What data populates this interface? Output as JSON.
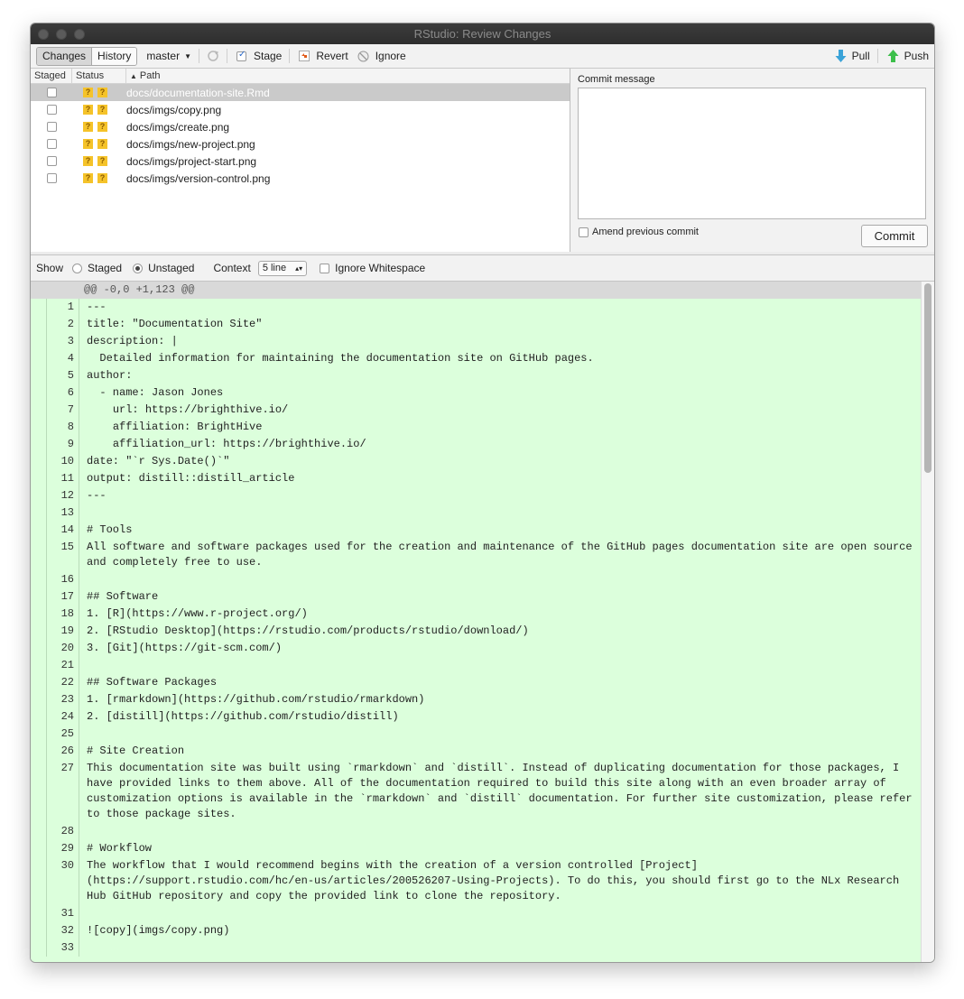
{
  "window": {
    "title": "RStudio: Review Changes"
  },
  "toolbar": {
    "changes_tab": "Changes",
    "history_tab": "History",
    "branch": "master",
    "stage": "Stage",
    "revert": "Revert",
    "ignore": "Ignore",
    "pull": "Pull",
    "push": "Push"
  },
  "file_list": {
    "headers": [
      "Staged",
      "Status",
      "Path"
    ],
    "rows": [
      {
        "path": "docs/documentation-site.Rmd",
        "status": [
          "?",
          "?"
        ]
      },
      {
        "path": "docs/imgs/copy.png",
        "status": [
          "?",
          "?"
        ]
      },
      {
        "path": "docs/imgs/create.png",
        "status": [
          "?",
          "?"
        ]
      },
      {
        "path": "docs/imgs/new-project.png",
        "status": [
          "?",
          "?"
        ]
      },
      {
        "path": "docs/imgs/project-start.png",
        "status": [
          "?",
          "?"
        ]
      },
      {
        "path": "docs/imgs/version-control.png",
        "status": [
          "?",
          "?"
        ]
      }
    ]
  },
  "commit": {
    "label": "Commit message",
    "message": "",
    "amend_label": "Amend previous commit",
    "button": "Commit"
  },
  "showbar": {
    "show": "Show",
    "staged": "Staged",
    "unstaged": "Unstaged",
    "context": "Context",
    "context_value": "5 line",
    "ignore_ws": "Ignore Whitespace"
  },
  "diff": {
    "hunk": "@@ -0,0 +1,123 @@",
    "lines": [
      {
        "n": "1",
        "t": "---"
      },
      {
        "n": "2",
        "t": "title: \"Documentation Site\""
      },
      {
        "n": "3",
        "t": "description: |"
      },
      {
        "n": "4",
        "t": "  Detailed information for maintaining the documentation site on GitHub pages."
      },
      {
        "n": "5",
        "t": "author:"
      },
      {
        "n": "6",
        "t": "  - name: Jason Jones"
      },
      {
        "n": "7",
        "t": "    url: https://brighthive.io/"
      },
      {
        "n": "8",
        "t": "    affiliation: BrightHive"
      },
      {
        "n": "9",
        "t": "    affiliation_url: https://brighthive.io/"
      },
      {
        "n": "10",
        "t": "date: \"`r Sys.Date()`\""
      },
      {
        "n": "11",
        "t": "output: distill::distill_article"
      },
      {
        "n": "12",
        "t": "---"
      },
      {
        "n": "13",
        "t": ""
      },
      {
        "n": "14",
        "t": "# Tools"
      },
      {
        "n": "15",
        "t": "All software and software packages used for the creation and maintenance of the GitHub pages documentation site are open source\nand completely free to use."
      },
      {
        "n": "16",
        "t": ""
      },
      {
        "n": "17",
        "t": "## Software"
      },
      {
        "n": "18",
        "t": "1. [R](https://www.r-project.org/)"
      },
      {
        "n": "19",
        "t": "2. [RStudio Desktop](https://rstudio.com/products/rstudio/download/)"
      },
      {
        "n": "20",
        "t": "3. [Git](https://git-scm.com/)"
      },
      {
        "n": "21",
        "t": ""
      },
      {
        "n": "22",
        "t": "## Software Packages"
      },
      {
        "n": "23",
        "t": "1. [rmarkdown](https://github.com/rstudio/rmarkdown)"
      },
      {
        "n": "24",
        "t": "2. [distill](https://github.com/rstudio/distill)"
      },
      {
        "n": "25",
        "t": ""
      },
      {
        "n": "26",
        "t": "# Site Creation"
      },
      {
        "n": "27",
        "t": "This documentation site was built using `rmarkdown` and `distill`. Instead of duplicating documentation for those packages, I\nhave provided links to them above. All of the documentation required to build this site along with an even broader array of\ncustomization options is available in the `rmarkdown` and `distill` documentation. For further site customization, please refer\nto those package sites."
      },
      {
        "n": "28",
        "t": ""
      },
      {
        "n": "29",
        "t": "# Workflow"
      },
      {
        "n": "30",
        "t": "The workflow that I would recommend begins with the creation of a version controlled [Project]\n(https://support.rstudio.com/hc/en-us/articles/200526207-Using-Projects). To do this, you should first go to the NLx Research\nHub GitHub repository and copy the provided link to clone the repository."
      },
      {
        "n": "31",
        "t": ""
      },
      {
        "n": "32",
        "t": "![copy](imgs/copy.png)"
      },
      {
        "n": "33",
        "t": ""
      }
    ]
  }
}
